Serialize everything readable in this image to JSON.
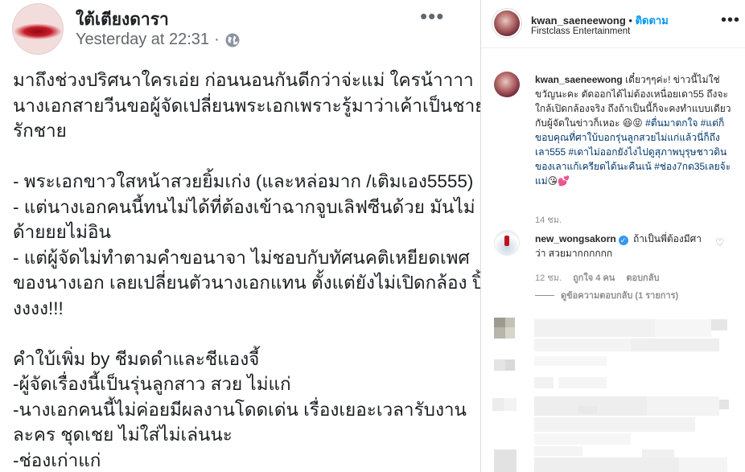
{
  "facebook_post": {
    "author": "ใต้เตียงดารา",
    "timestamp": "Yesterday at 22:31",
    "separator": "·",
    "privacy_icon": "globe-icon",
    "more_icon": "more-horizontal-icon",
    "body_lines": [
      "มาถึงช่วงปริศนาใครเอ่ย ก่อนนอนกันดีกว่าจ่ะแม่ ใครน้าาาา",
      "นางเอกสายวีนขอผู้จัดเปลี่ยนพระเอกเพราะรู้มาว่าเค้าเป็นชาย",
      "รักชาย",
      "",
      "- พระเอกขาวใสหน้าสวยยิ้มเก่ง (และหล่อมาก /เติมเอง5555)",
      "- แต่นางเอกคนนี้ทนไม่ได้ที่ต้องเข้าฉากจูบเลิฟซีนด้วย มันไม่",
      "ด้ายยยไม่อิน",
      "- แต่ผู้จัดไม่ทำตามคำขอนาจา ไม่ชอบกับทัศนคติเหยียดเพศ",
      "ของนางเอก เลยเปลี่ยนตัวนางเอกแทน ตั้งแต่ยังไม่เปิดกล้อง ปิ้",
      "งงงง!!!",
      "",
      "คำใบ้เพิ่ม by ชีมดดำและชีแองจี้",
      "-ผู้จัดเรื่องนี้เป็นรุ่นลูกสาว สวย ไม่แก่",
      "-นางเอกคนนี้ไม่ค่อยมีผลงานโดดเด่น เรื่องเยอะเวลารับงาน",
      "ละคร ชุดเชย ไม่ใส่ไม่เล่นนะ",
      "-ช่องเก่าแก่"
    ]
  },
  "instagram": {
    "header": {
      "username": "kwan_saeneewong",
      "dot": "•",
      "follow_label": "ติดตาม",
      "subtitle": "Firstclass Entertainment",
      "more_icon": "more-horizontal-icon"
    },
    "caption": {
      "username": "kwan_saeneewong",
      "text_1": "เดี๋ยวๆๆค่ะ! ข่าวนี้ไม่ใช่ขวัญนะคะ ตัดออกได้ไม่ต้องเหนื่อยเดา55 ถึงจะใกล้เปิดกล้องจริง ถึงถ้าเป็นนี้ก็จะคงทำแบบเดียวกับผู้จัดในข่าวก็เหอะ",
      "emoji_1": "😆😝",
      "hashtags": "#ตื่นมาตกใจ #แต่ก็ขอบคุณที่ศาใบ้บอกรุ่นลูกสวยไม่แก่แล้วนี่ก็ถึงเลา555 #เดาไม่ออกยังไงไปดูสุภาพบุรุษชาวดินของเลาแก้เครียดได้นะคืนเน้ #ช่อง7กด35เลยจ้ะแม่",
      "emoji_2": "😘💕",
      "time": "14 ชม."
    },
    "comment": {
      "username": "new_wongsakorn",
      "verified_icon": "verified-badge-icon",
      "text": "ถ้าเป็นพี่ต้องมีศาว่า สวยมากกกกกก",
      "time": "12 ชม.",
      "likes": "ถูกใจ 4 คน",
      "reply_label": "ตอบกลับ",
      "heart_icon": "heart-outline-icon",
      "view_replies": "ดูข้อความตอบกลับ (1 รายการ)"
    },
    "blurred_area": "pixelated-comments"
  },
  "colors": {
    "ig_link_blue": "#0095f6",
    "hashtag_blue": "#00376b",
    "fb_text": "#1c1e21",
    "fb_meta": "#65676b"
  }
}
